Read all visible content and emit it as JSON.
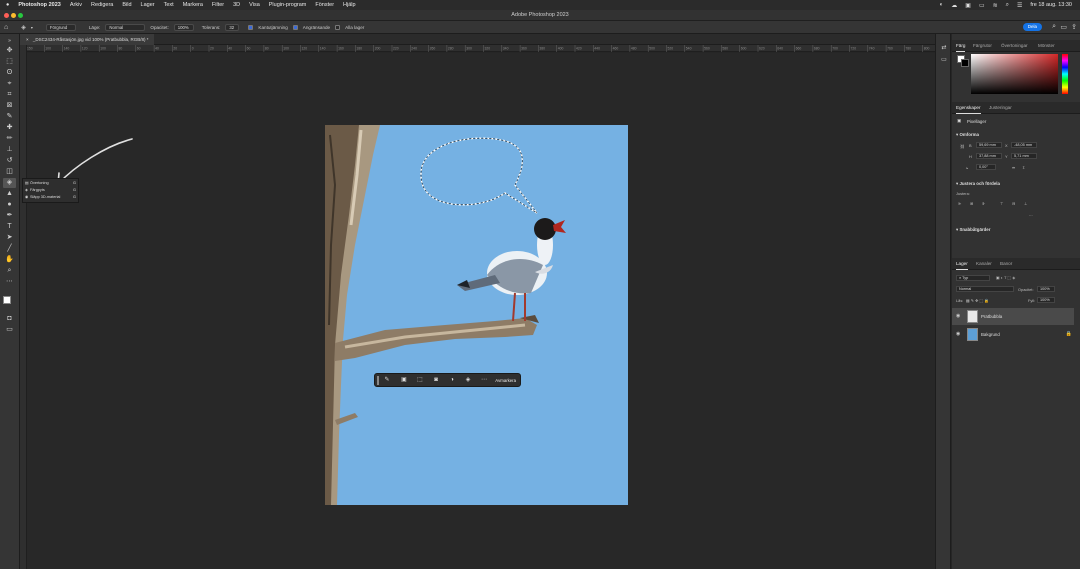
{
  "menubar": {
    "apple": "",
    "items": [
      "Photoshop 2023",
      "Arkiv",
      "Redigera",
      "Bild",
      "Lager",
      "Text",
      "Markera",
      "Filter",
      "3D",
      "Visa",
      "Plugin-program",
      "Fönster",
      "Hjälp"
    ],
    "clock": "fre 18 aug. 13:30"
  },
  "titlebar": {
    "title": "Adobe Photoshop 2023"
  },
  "optionsbar": {
    "fill_source": "Förgrund",
    "mode_label": "Läge:",
    "mode_value": "Normal",
    "opacity_label": "Opacitet:",
    "opacity_value": "100%",
    "tolerance_label": "Tolerans:",
    "tolerance_value": "32",
    "antialias_label": "Kantutjämning",
    "contiguous_label": "Angränsande",
    "all_layers_label": "Alla lager",
    "share_label": "Dela"
  },
  "document": {
    "tab_title": "_DSC2434-Råstasjön.jpg vid 100% (Pratbubbla, RGB/8) *"
  },
  "ruler": {
    "labels": [
      "150",
      "100",
      "140",
      "120",
      "100",
      "80",
      "60",
      "40",
      "20",
      "0",
      "20",
      "40",
      "60",
      "80",
      "100",
      "120",
      "140",
      "160",
      "180",
      "200",
      "220",
      "240",
      "260",
      "280",
      "300",
      "320",
      "340",
      "360",
      "380",
      "400",
      "420",
      "440",
      "460",
      "480",
      "500",
      "520",
      "540",
      "560",
      "580",
      "600",
      "620",
      "640",
      "660",
      "680",
      "700",
      "720",
      "740",
      "760",
      "780",
      "800"
    ]
  },
  "flyout": {
    "items": [
      {
        "label": "Övertoning",
        "key": "G"
      },
      {
        "label": "Färgpyts",
        "key": "G"
      },
      {
        "label": "Släpp 3D-material",
        "key": "G"
      }
    ]
  },
  "taskbar": {
    "action_label": "Avmarkera"
  },
  "color_panel": {
    "tabs": [
      "Färg",
      "Färgrutor",
      "Övertoningar",
      "Mönster"
    ],
    "hue_color": "#d22727"
  },
  "properties_panel": {
    "tabs": [
      "Egenskaper",
      "Justeringar"
    ],
    "layer_type": "Pixellager",
    "transform_title": "Omforma",
    "w_label": "B",
    "w_value": "59,69 mm",
    "x_label": "X",
    "x_value": "-48,05 mm",
    "h_label": "H",
    "h_value": "37,88 mm",
    "y_label": "Y",
    "y_value": "5,71 mm",
    "angle_value": "0,00°",
    "align_title": "Justera och fördela",
    "align_sub": "Justera:",
    "quick_title": "Snabbåtgärder"
  },
  "layers_panel": {
    "tabs": [
      "Lager",
      "Kanaler",
      "Banor"
    ],
    "filter_label": "Typ",
    "blend_mode": "Normal",
    "opacity_label": "Opacitet:",
    "opacity_value": "100%",
    "lock_label": "Lås:",
    "fill_label": "Fyll:",
    "fill_value": "100%",
    "layers": [
      {
        "name": "Pratbubbla",
        "selected": true
      },
      {
        "name": "Bakgrund",
        "selected": false
      }
    ]
  }
}
